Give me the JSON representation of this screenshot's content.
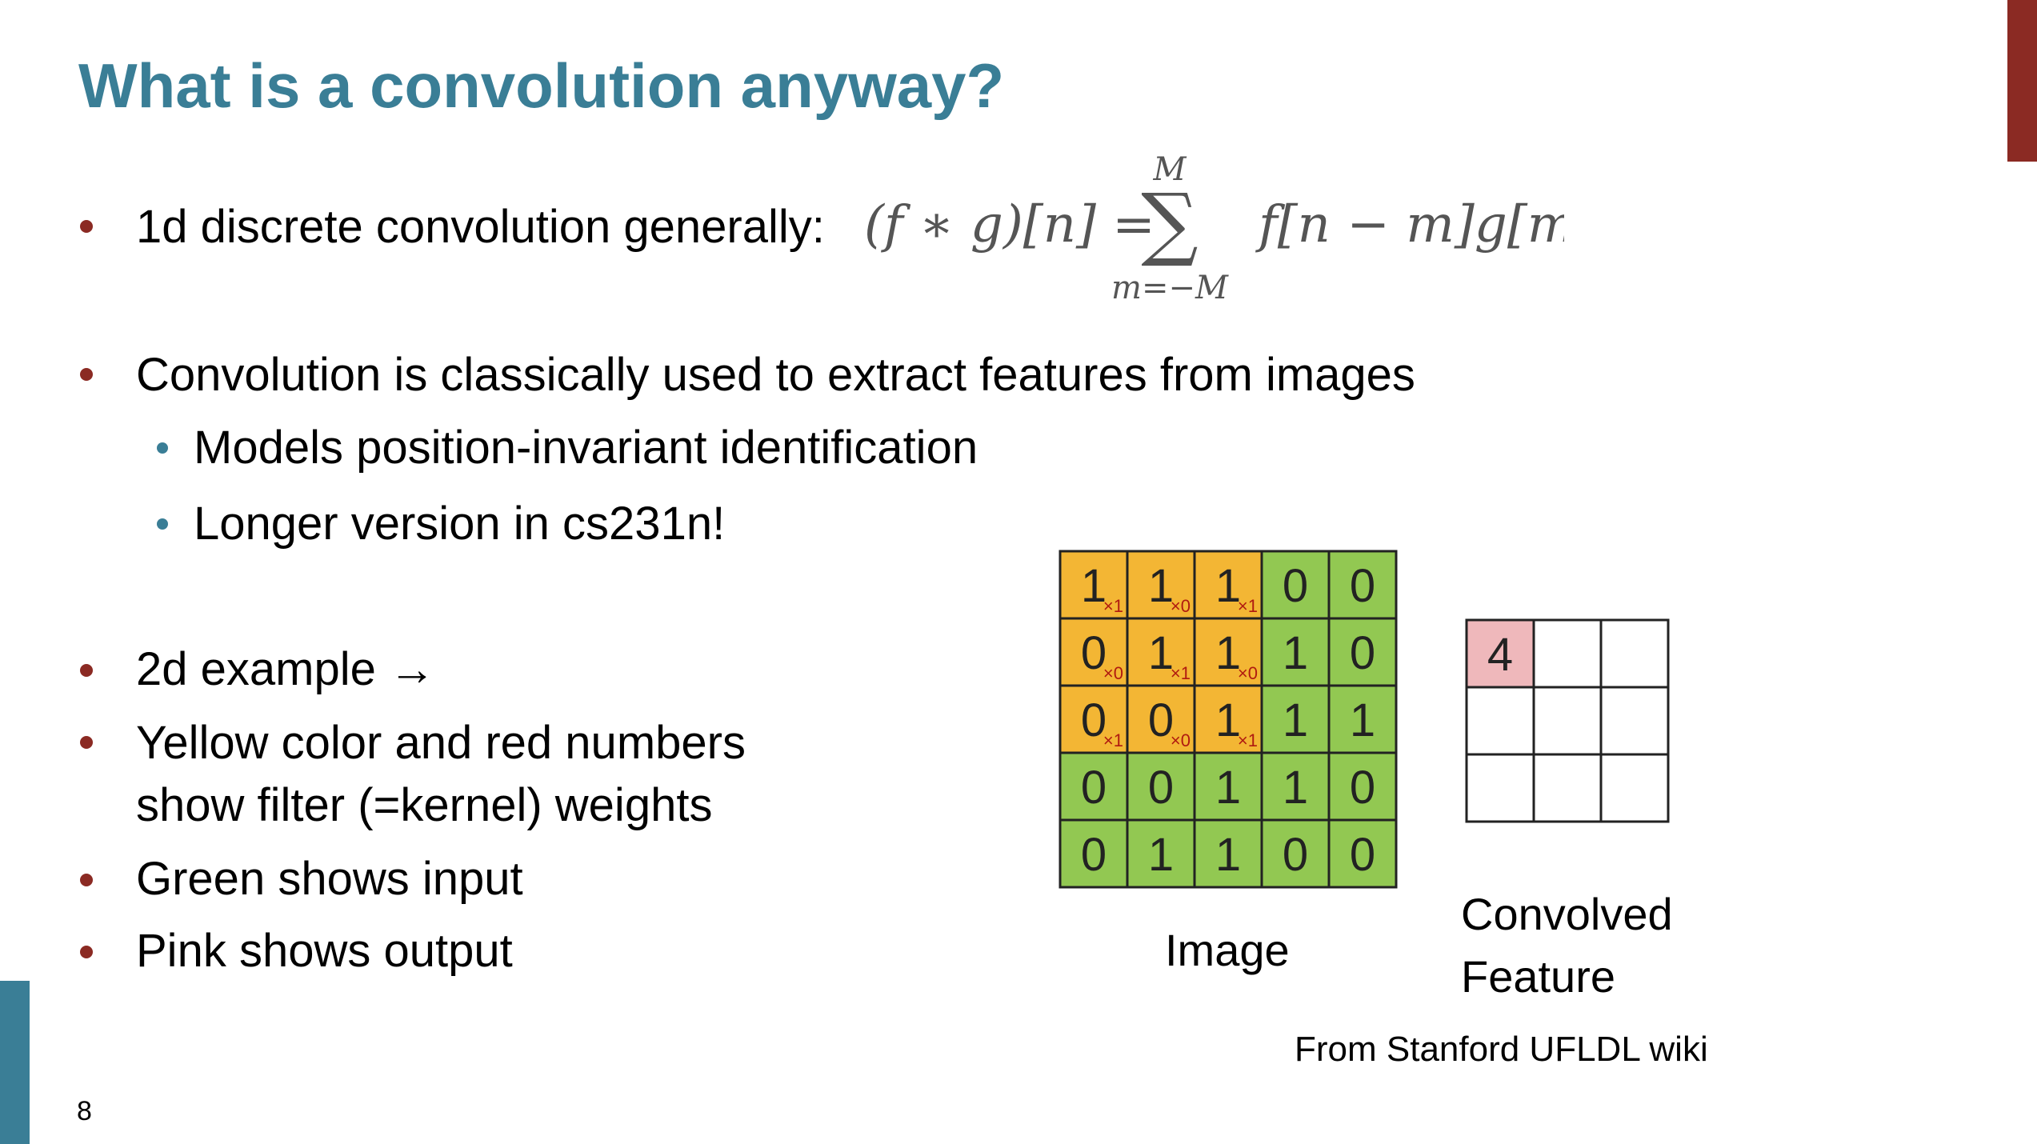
{
  "slide": {
    "title": "What is a convolution anyway?",
    "slide_number": "8"
  },
  "bullets": {
    "b1": "1d discrete convolution generally:",
    "b2": "Convolution is classically used to extract features from images",
    "b2a": "Models position-invariant identification",
    "b2b": "Longer version in cs231n!",
    "b3": "2d example →",
    "b4_line1": "Yellow color and red numbers",
    "b4_line2": "show filter (=kernel) weights",
    "b5": "Green shows input",
    "b6": "Pink shows output"
  },
  "formula": {
    "lhs": "(f ∗ g)[n] =",
    "sum_top": "M",
    "sum_symbol": "∑",
    "sum_bottom": "m=−M",
    "rhs": "f[n − m]g[m]."
  },
  "figure": {
    "image_grid": [
      [
        1,
        1,
        1,
        0,
        0
      ],
      [
        0,
        1,
        1,
        1,
        0
      ],
      [
        0,
        0,
        1,
        1,
        1
      ],
      [
        0,
        0,
        1,
        1,
        0
      ],
      [
        0,
        1,
        1,
        0,
        0
      ]
    ],
    "kernel_weights": [
      [
        "×1",
        "×0",
        "×1"
      ],
      [
        "×0",
        "×1",
        "×0"
      ],
      [
        "×1",
        "×0",
        "×1"
      ]
    ],
    "output_grid": [
      [
        "4",
        "",
        ""
      ],
      [
        "",
        "",
        ""
      ],
      [
        "",
        "",
        ""
      ]
    ],
    "image_label": "Image",
    "output_label_line1": "Convolved",
    "output_label_line2": "Feature",
    "source": "From Stanford UFLDL wiki",
    "colors": {
      "input": "#92c852",
      "kernel": "#f3b634",
      "output": "#efb8bb",
      "empty": "#ffffff",
      "border": "#222222"
    }
  }
}
